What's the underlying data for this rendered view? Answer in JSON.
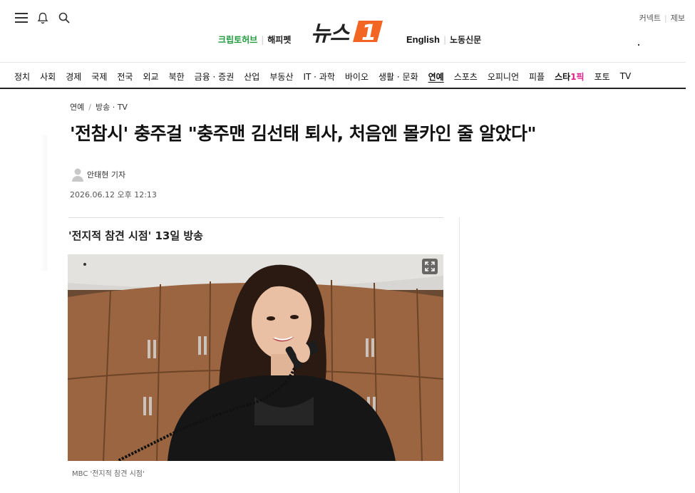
{
  "header": {
    "logo_text": "뉴스",
    "logo_badge": "1",
    "util_links": [
      "커넥트",
      "제보"
    ],
    "promo_left": [
      "크립토허브",
      "해피펫"
    ],
    "promo_right": [
      "English",
      "노동신문"
    ]
  },
  "icons": [
    "menu-icon",
    "bell-icon",
    "search-icon",
    "expand-icon",
    "reporter-avatar-icon"
  ],
  "nav": {
    "items": [
      "정치",
      "사회",
      "경제",
      "국제",
      "전국",
      "외교",
      "북한",
      "금융 · 증권",
      "산업",
      "부동산",
      "IT · 과학",
      "바이오",
      "생활 · 문화",
      "연예",
      "스포츠",
      "오피니언",
      "피플",
      "스타1픽",
      "포토",
      "TV"
    ],
    "active": "연예"
  },
  "article": {
    "breadcrumb": [
      "연예",
      "방송 · TV"
    ],
    "headline": "'전참시' 충주걸 \"충주맨 김선태 퇴사, 처음엔 몰카인 줄 알았다\"",
    "author": "안태현 기자",
    "date": "2026.06.12 오후 12:13",
    "subtitle": "'전지적 참견 시점' 13일 방송",
    "caption": "MBC '전지적 참견 시점'"
  },
  "colors": {
    "brand_orange": "#f26522",
    "promo_green": "#1f9a3c",
    "star_pink": "#e0218a"
  }
}
